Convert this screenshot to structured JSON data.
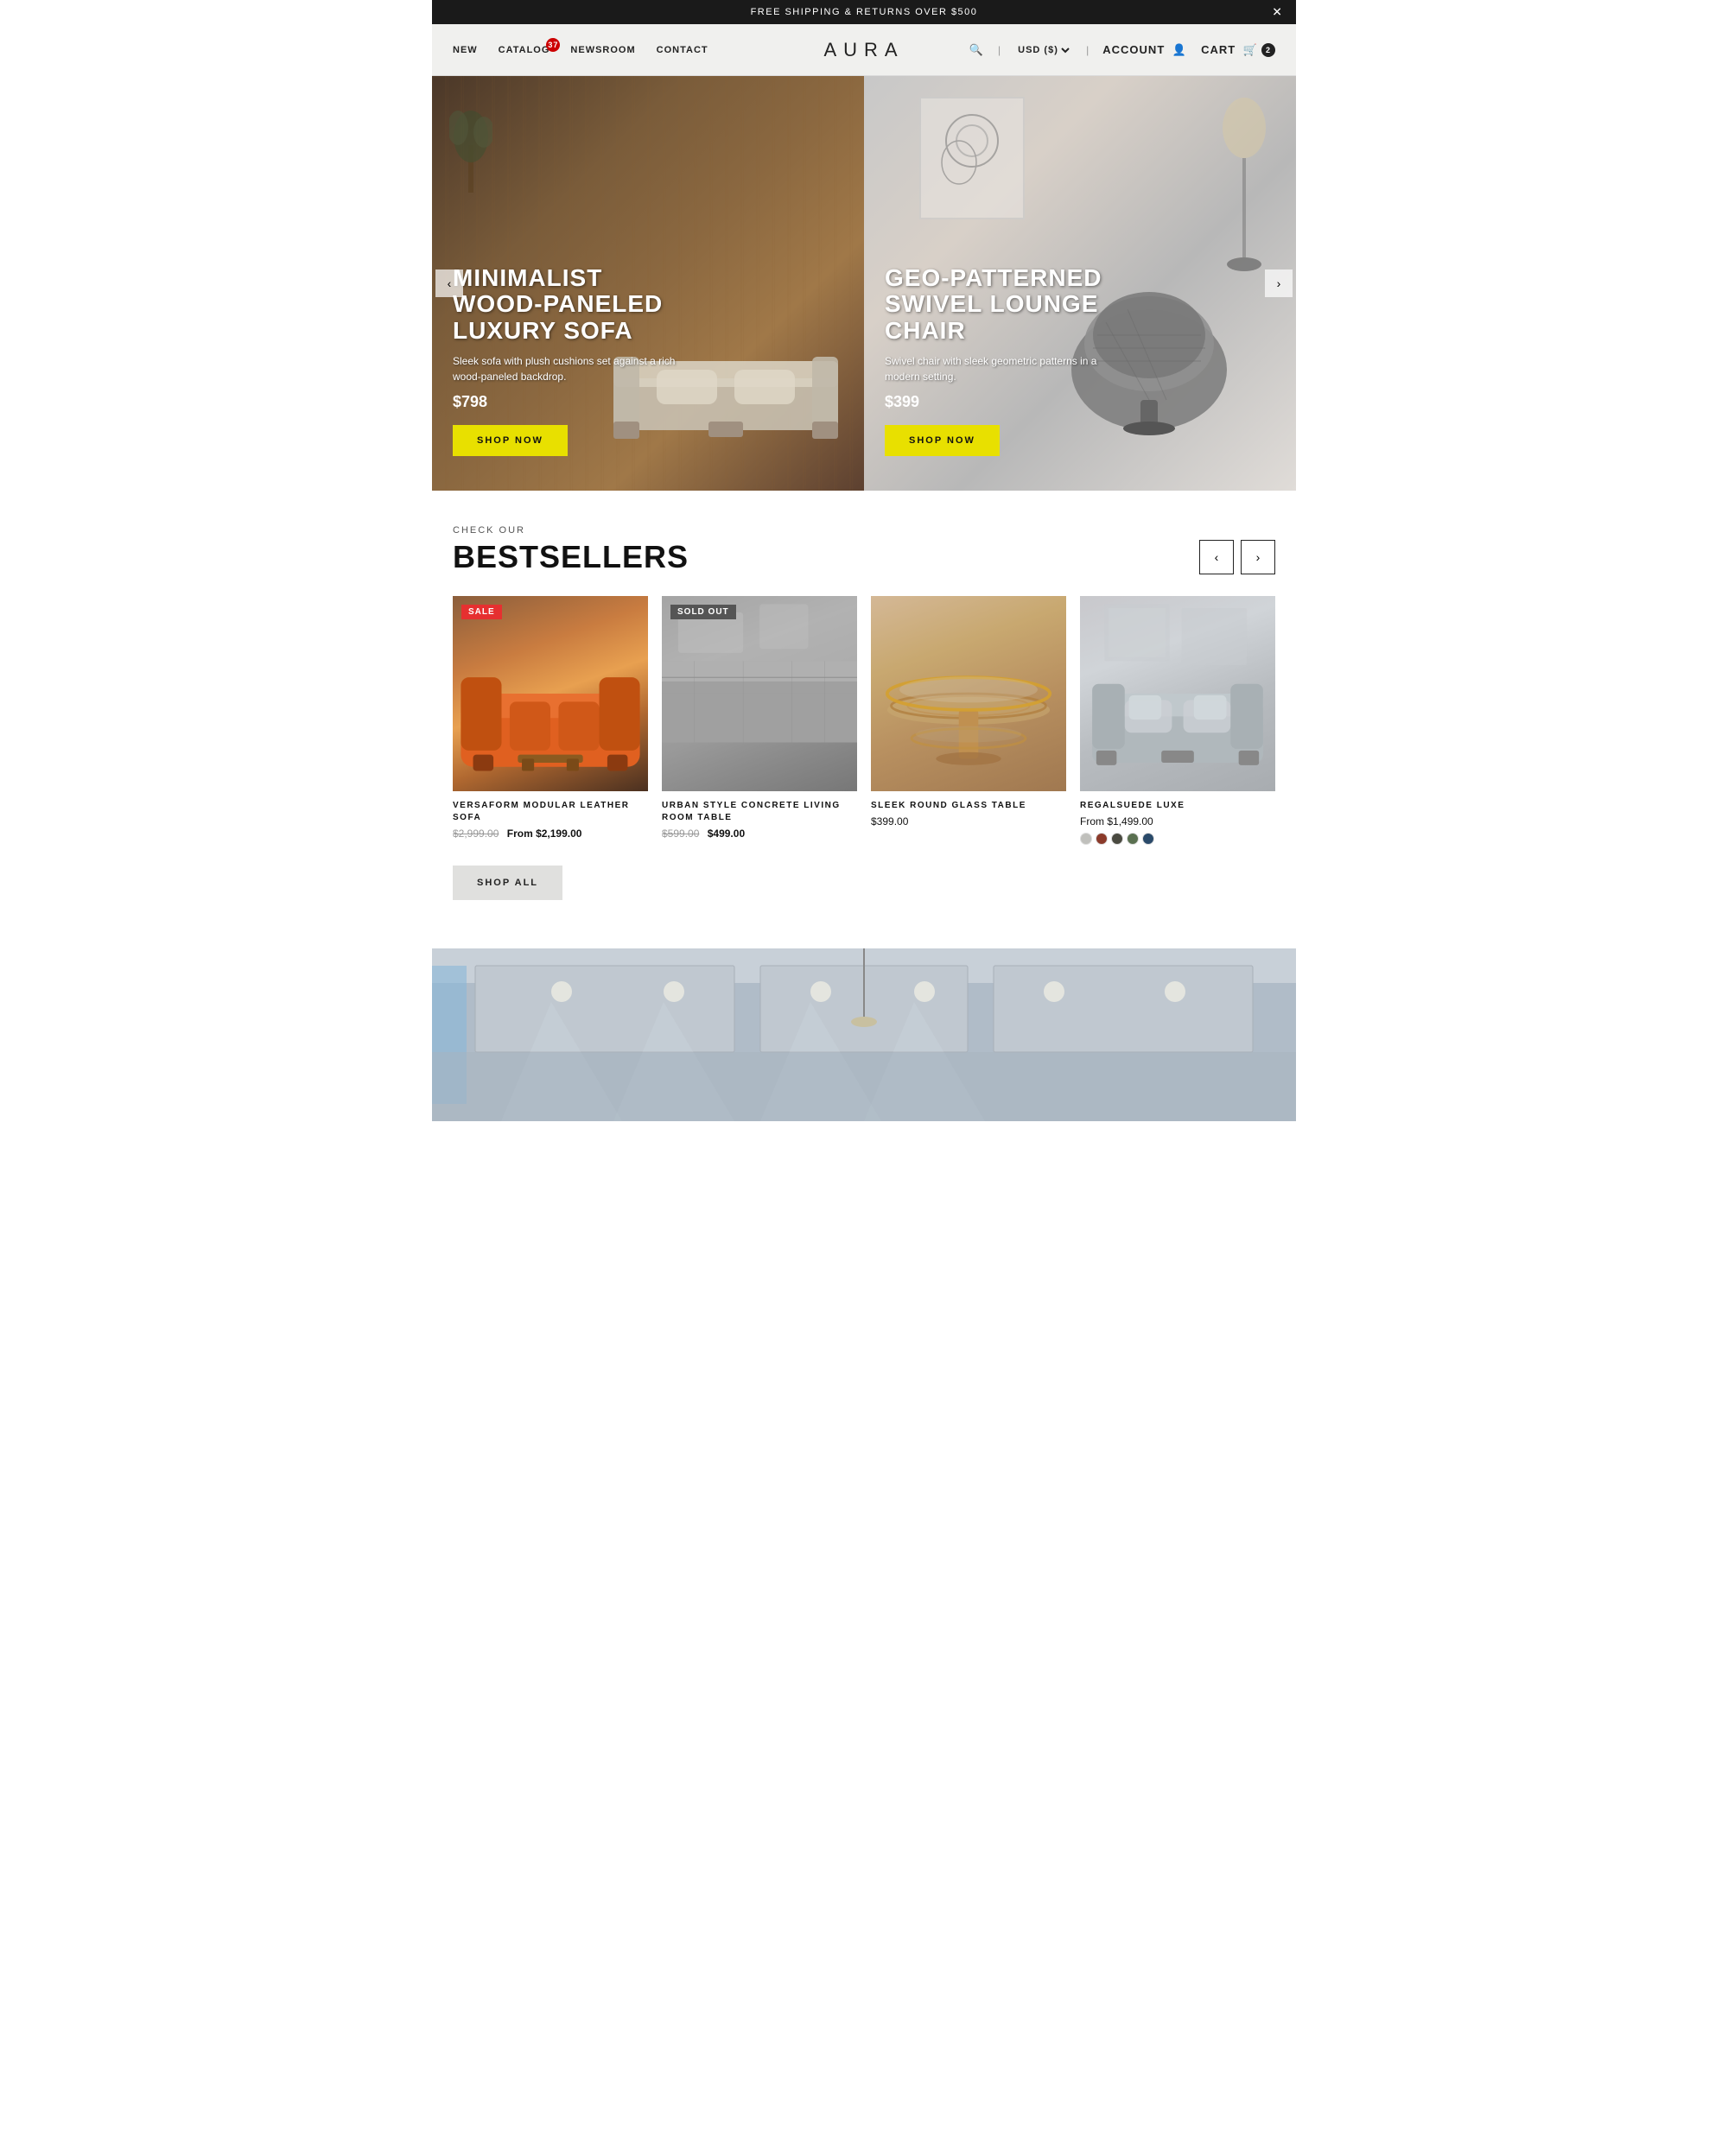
{
  "announcement": {
    "text": "FREE SHIPPING & RETURNS OVER $500",
    "close_label": "✕"
  },
  "header": {
    "logo": "AURA",
    "nav_left": [
      {
        "id": "new",
        "label": "NEW"
      },
      {
        "id": "catalog",
        "label": "CATALOG",
        "badge": "37"
      },
      {
        "id": "newsroom",
        "label": "NEWSROOM"
      },
      {
        "id": "contact",
        "label": "CONTACT"
      }
    ],
    "search_label": "🔍",
    "currency": "USD ($)",
    "account_label": "ACCOUNT",
    "cart_label": "CART",
    "cart_count": "2"
  },
  "hero": {
    "prev_label": "‹",
    "next_label": "›",
    "slides": [
      {
        "id": "slide-1",
        "title": "MINIMALIST WOOD-PANELED LUXURY SOFA",
        "description": "Sleek sofa with plush cushions set against a rich wood-paneled backdrop.",
        "price": "$798",
        "cta": "SHOP NOW"
      },
      {
        "id": "slide-2",
        "title": "GEO-PATTERNED SWIVEL LOUNGE CHAIR",
        "description": "Swivel chair with sleek geometric patterns in a modern setting.",
        "price": "$399",
        "cta": "SHOP NOW"
      }
    ]
  },
  "bestsellers": {
    "section_label": "CHECK OUR",
    "section_title": "BESTSELLERS",
    "prev_label": "‹",
    "next_label": "›",
    "products": [
      {
        "id": "prod-1",
        "name": "VERSAFORM MODULAR LEATHER SOFA",
        "original_price": "$2,999.00",
        "sale_price": "From $2,199.00",
        "badge": "SALE",
        "badge_type": "sale",
        "has_swatches": false
      },
      {
        "id": "prod-2",
        "name": "URBAN STYLE CONCRETE LIVING ROOM TABLE",
        "original_price": "$599.00",
        "sale_price": "$499.00",
        "badge": "SOLD OUT",
        "badge_type": "soldout",
        "has_swatches": false
      },
      {
        "id": "prod-3",
        "name": "SLEEK ROUND GLASS TABLE",
        "price": "$399.00",
        "has_swatches": false
      },
      {
        "id": "prod-4",
        "name": "REGALSUEDE LUXE",
        "price_prefix": "From",
        "price": "$1,499.00",
        "has_swatches": true,
        "swatches": [
          {
            "color": "#c0c0bc"
          },
          {
            "color": "#8b3a2a"
          },
          {
            "color": "#4a4a40"
          },
          {
            "color": "#5a7050"
          },
          {
            "color": "#2a4a6a"
          }
        ]
      }
    ],
    "shop_all_label": "SHOP ALL"
  }
}
